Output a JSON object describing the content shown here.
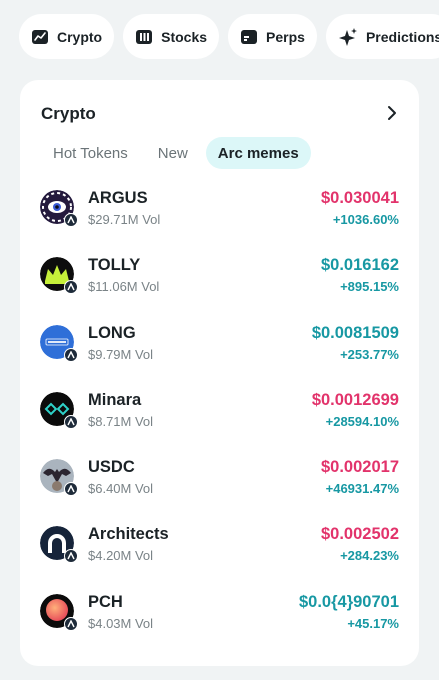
{
  "nav_chips": [
    {
      "label": "Crypto",
      "icon": "chart-line-icon"
    },
    {
      "label": "Stocks",
      "icon": "bar-chart-icon"
    },
    {
      "label": "Perps",
      "icon": "perps-icon"
    },
    {
      "label": "Predictions",
      "icon": "sparkle-icon"
    }
  ],
  "card": {
    "title": "Crypto",
    "tabs": [
      {
        "label": "Hot Tokens",
        "active": false
      },
      {
        "label": "New",
        "active": false
      },
      {
        "label": "Arc memes",
        "active": true
      }
    ]
  },
  "colors": {
    "price_pink": "#e2336b",
    "price_teal": "#1798a3",
    "change_teal": "#1798a3",
    "active_tab_bg": "#dcf7f8"
  },
  "tokens": [
    {
      "name": "ARGUS",
      "vol": "$29.71M Vol",
      "price": "$0.030041",
      "change": "+1036.60%",
      "price_color": "pink",
      "logo": "argus-eye-logo"
    },
    {
      "name": "TOLLY",
      "vol": "$11.06M Vol",
      "price": "$0.016162",
      "change": "+895.15%",
      "price_color": "teal",
      "logo": "tolly-crown-logo"
    },
    {
      "name": "LONG",
      "vol": "$9.79M Vol",
      "price": "$0.0081509",
      "change": "+253.77%",
      "price_color": "teal",
      "logo": "long-logo"
    },
    {
      "name": "Minara",
      "vol": "$8.71M Vol",
      "price": "$0.0012699",
      "change": "+28594.10%",
      "price_color": "pink",
      "logo": "minara-logo"
    },
    {
      "name": "USDC",
      "vol": "$6.40M Vol",
      "price": "$0.002017",
      "change": "+46931.47%",
      "price_color": "pink",
      "logo": "usdc-bat-logo"
    },
    {
      "name": "Architects",
      "vol": "$4.20M Vol",
      "price": "$0.002502",
      "change": "+284.23%",
      "price_color": "pink",
      "logo": "architects-arch-logo"
    },
    {
      "name": "PCH",
      "vol": "$4.03M Vol",
      "price": "$0.0{4}90701",
      "change": "+45.17%",
      "price_color": "teal",
      "logo": "pch-orb-logo"
    }
  ]
}
